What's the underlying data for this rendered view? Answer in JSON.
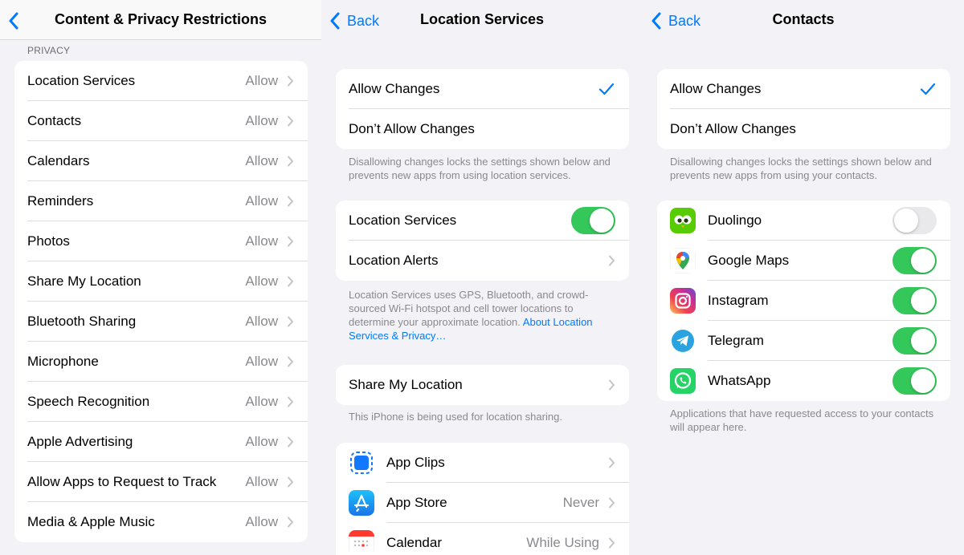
{
  "panel1": {
    "title": "Content & Privacy Restrictions",
    "section_header": "PRIVACY",
    "items": [
      {
        "label": "Location Services",
        "value": "Allow"
      },
      {
        "label": "Contacts",
        "value": "Allow"
      },
      {
        "label": "Calendars",
        "value": "Allow"
      },
      {
        "label": "Reminders",
        "value": "Allow"
      },
      {
        "label": "Photos",
        "value": "Allow"
      },
      {
        "label": "Share My Location",
        "value": "Allow"
      },
      {
        "label": "Bluetooth Sharing",
        "value": "Allow"
      },
      {
        "label": "Microphone",
        "value": "Allow"
      },
      {
        "label": "Speech Recognition",
        "value": "Allow"
      },
      {
        "label": "Apple Advertising",
        "value": "Allow"
      },
      {
        "label": "Allow Apps to Request to Track",
        "value": "Allow"
      },
      {
        "label": "Media & Apple Music",
        "value": "Allow"
      }
    ]
  },
  "panel2": {
    "back_label": "Back",
    "title": "Location Services",
    "allow_changes": "Allow Changes",
    "dont_allow_changes": "Don’t Allow Changes",
    "changes_footnote": "Disallowing changes locks the settings shown below and prevents new apps from using location services.",
    "location_services_label": "Location Services",
    "location_services_on": true,
    "location_alerts_label": "Location Alerts",
    "location_footnote": "Location Services uses GPS, Bluetooth, and crowd-sourced Wi-Fi hotspot and cell tower locations to determine your approximate location.",
    "location_footnote_link": "About Location Services & Privacy…",
    "share_my_location_label": "Share My Location",
    "share_footnote": "This iPhone is being used for location sharing.",
    "apps": [
      {
        "label": "App Clips",
        "value": "",
        "icon": "app-clips-icon"
      },
      {
        "label": "App Store",
        "value": "Never",
        "icon": "app-store-icon"
      },
      {
        "label": "Calendar",
        "value": "While Using",
        "icon": "calendar-icon"
      }
    ]
  },
  "panel3": {
    "back_label": "Back",
    "title": "Contacts",
    "allow_changes": "Allow Changes",
    "dont_allow_changes": "Don’t Allow Changes",
    "changes_footnote": "Disallowing changes locks the settings shown below and prevents new apps from using your contacts.",
    "apps": [
      {
        "label": "Duolingo",
        "enabled": false,
        "icon": "duolingo-icon"
      },
      {
        "label": "Google Maps",
        "enabled": true,
        "icon": "google-maps-icon"
      },
      {
        "label": "Instagram",
        "enabled": true,
        "icon": "instagram-icon"
      },
      {
        "label": "Telegram",
        "enabled": true,
        "icon": "telegram-icon"
      },
      {
        "label": "WhatsApp",
        "enabled": true,
        "icon": "whatsapp-icon"
      }
    ],
    "apps_footnote": "Applications that have requested access to your contacts will appear here."
  },
  "colors": {
    "accent": "#007aff",
    "toggle_on": "#34c759",
    "toggle_off": "#e9e9eb",
    "background": "#f2f2f7"
  }
}
